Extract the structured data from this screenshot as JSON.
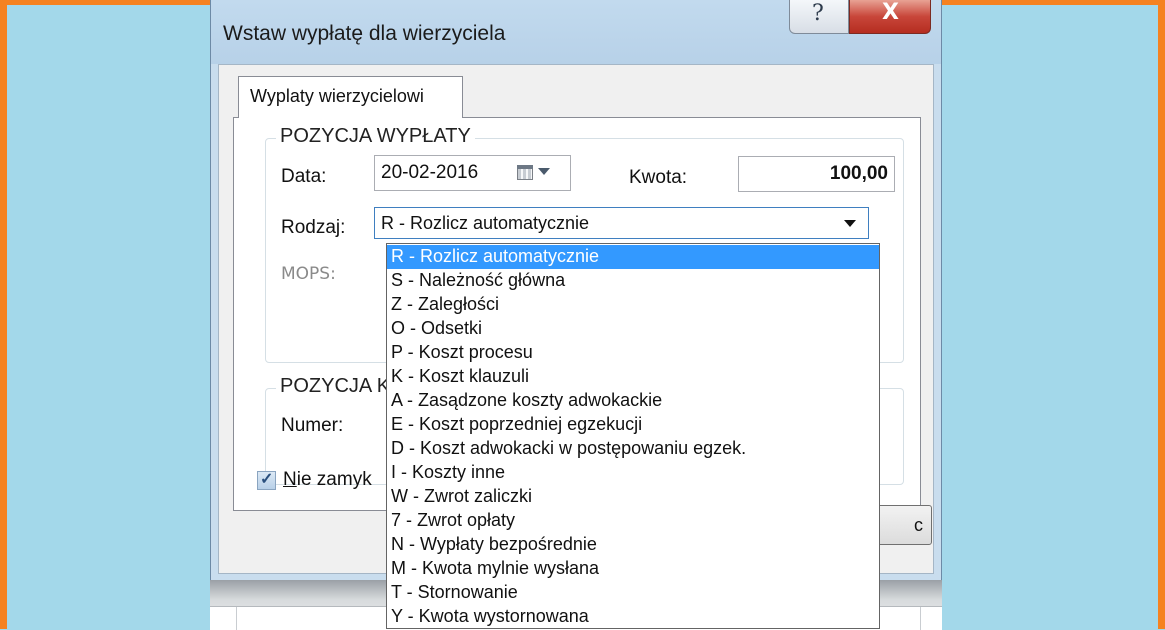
{
  "window": {
    "title": "Wstaw wypłatę dla wierzyciela",
    "help_glyph": "?",
    "close_glyph": "X"
  },
  "tab": {
    "label": "Wyplaty wierzycielowi"
  },
  "group_payment": {
    "legend": "POZYCJA WYPŁATY",
    "date_label": "Data:",
    "date_value": "20-02-2016",
    "amount_label": "Kwota:",
    "amount_value": "100,00",
    "type_label": "Rodzaj:",
    "type_value": "R - Rozlicz automatycznie",
    "mops_label": "MOPS:"
  },
  "group_second": {
    "legend": "POZYCJA K",
    "number_label": "Numer:"
  },
  "checkbox": {
    "label": "Nie zamyk",
    "checked": true,
    "glyph": "✓"
  },
  "partial_button": {
    "label": "c"
  },
  "dropdown": {
    "selected_index": 0,
    "items": [
      "R - Rozlicz automatycznie",
      "S - Należność główna",
      "Z - Zaległości",
      "O - Odsetki",
      "P - Koszt procesu",
      "K - Koszt klauzuli",
      "A - Zasądzone koszty adwokackie",
      "E - Koszt poprzedniej egzekucji",
      "D - Koszt adwokacki w postępowaniu egzek.",
      "I - Koszty inne",
      "W - Zwrot zaliczki",
      "7 - Zwrot opłaty",
      "N - Wypłaty bezpośrednie",
      "M - Kwota mylnie wysłana",
      "T - Stornowanie",
      "Y - Kwota wystornowana"
    ]
  },
  "colors": {
    "desktop": "#a3d8ea",
    "frame": "#f58220",
    "selection": "#3399ff"
  }
}
